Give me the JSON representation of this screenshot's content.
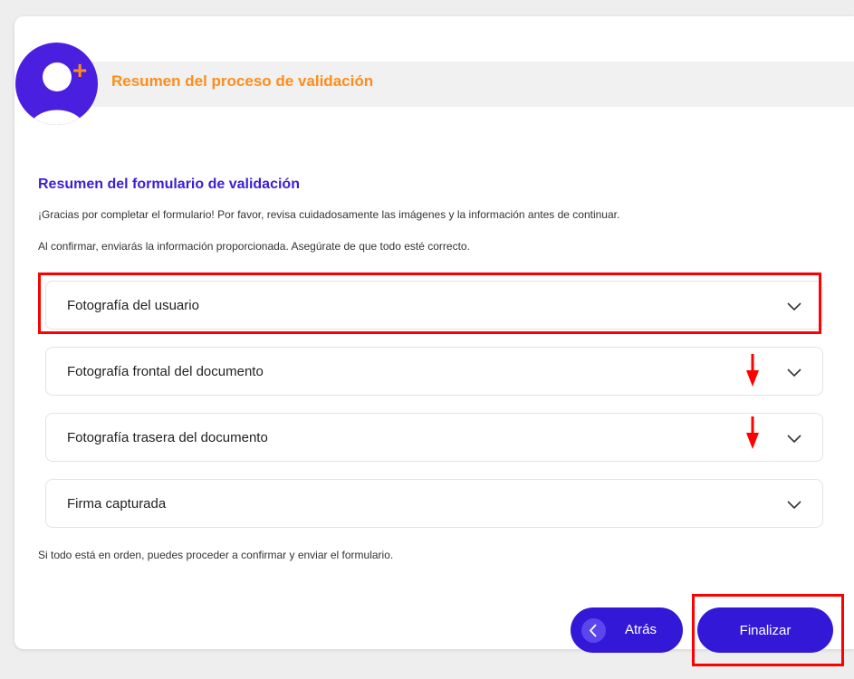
{
  "header": {
    "title": "Resumen del proceso de validación",
    "plus_symbol": "+"
  },
  "section": {
    "title": "Resumen del formulario de validación",
    "intro": "¡Gracias por completar el formulario! Por favor, revisa cuidadosamente las imágenes y la información antes de continuar.",
    "confirm_note": "Al confirmar, enviarás la información proporcionada. Asegúrate de que todo esté correcto."
  },
  "accordion": {
    "items": [
      {
        "label": "Fotografía del usuario",
        "expanded": false
      },
      {
        "label": "Fotografía frontal del documento",
        "expanded": false
      },
      {
        "label": "Fotografía trasera del documento",
        "expanded": false
      },
      {
        "label": "Firma capturada",
        "expanded": false
      }
    ]
  },
  "footer_note": "Si todo está en orden, puedes proceder a confirmar y enviar el formulario.",
  "buttons": {
    "back_label": "Atrás",
    "finish_label": "Finalizar"
  },
  "colors": {
    "accent": "#3418d8",
    "header_title": "#ff8c1a",
    "annotation": "#ff0000"
  }
}
